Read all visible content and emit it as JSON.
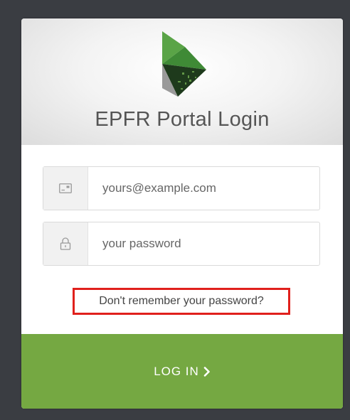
{
  "header": {
    "title": "EPFR Portal Login"
  },
  "form": {
    "email": {
      "placeholder": "yours@example.com",
      "icon": "id-card-icon"
    },
    "password": {
      "placeholder": "your password",
      "icon": "lock-icon"
    },
    "forgot_label": "Don't remember your password?",
    "submit_label": "LOG IN"
  },
  "colors": {
    "accent": "#75a842",
    "highlight_border": "#e0201c",
    "logo_green": "#4d9a3e"
  }
}
